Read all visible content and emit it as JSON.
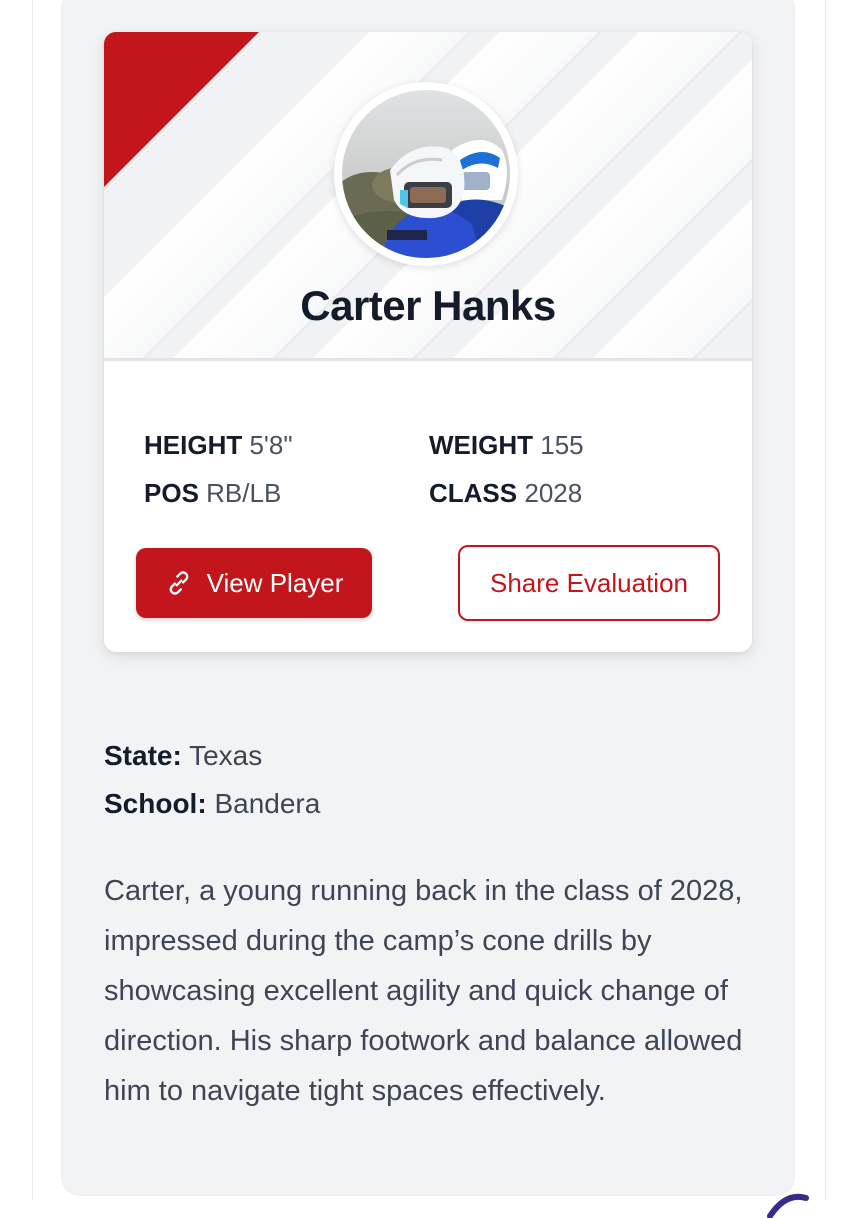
{
  "player": {
    "name": "Carter Hanks",
    "avatar_icon": "player-photo"
  },
  "stats": {
    "height_label": "HEIGHT",
    "height_value": "5'8\"",
    "weight_label": "WEIGHT",
    "weight_value": "155",
    "pos_label": "POS",
    "pos_value": "RB/LB",
    "class_label": "CLASS",
    "class_value": "2028"
  },
  "actions": {
    "view_player": "View Player",
    "view_player_icon": "link-icon",
    "share_evaluation": "Share Evaluation"
  },
  "details": {
    "state_label": "State:",
    "state_value": "Texas",
    "school_label": "School:",
    "school_value": "Bandera"
  },
  "evaluation": {
    "text": "Carter, a young running back in the class of 2028, impressed during the camp’s cone drills by showcasing excellent agility and quick change of direction. His sharp footwork and balance allowed him to navigate tight spaces effectively."
  },
  "colors": {
    "accent": "#c3161c",
    "name_text": "#141c2c",
    "body_text": "#3e4555",
    "panel_bg": "#f2f3f5"
  }
}
